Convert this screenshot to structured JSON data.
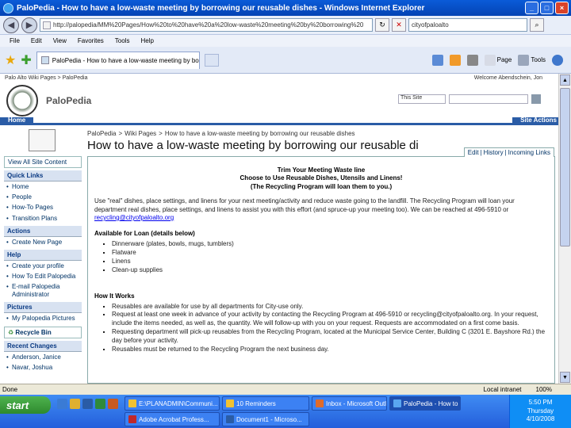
{
  "window": {
    "title": "PaloPedia - How to have a low-waste meeting by borrowing our reusable dishes - Windows Internet Explorer",
    "controls": [
      "_",
      "□",
      "×"
    ]
  },
  "address_bar": {
    "url": "http://palopedia/MM%20Pages/How%20to%20have%20a%20low-waste%20meeting%20by%20borrowing%20",
    "search_value": "cityofpaloalto"
  },
  "menu": [
    "File",
    "Edit",
    "View",
    "Favorites",
    "Tools",
    "Help"
  ],
  "tab": {
    "label": "PaloPedia - How to have a low-waste meeting by borr..."
  },
  "command_bar": {
    "page": "Page",
    "tools": "Tools"
  },
  "sharepoint": {
    "top_left": "Palo Alto Wiki Pages > PaloPedia",
    "top_right": "Welcome Abendschein, Jon",
    "site_name": "PaloPedia",
    "search_scope": "This Site",
    "home_tab": "Home",
    "site_actions": "Site Actions"
  },
  "breadcrumb": {
    "items": [
      "PaloPedia",
      "Wiki Pages",
      "How to have a low-waste meeting by borrowing our reusable dishes"
    ],
    "separator": ">"
  },
  "page_title": "How to have a low-waste meeting by borrowing our reusable di",
  "content_tabs": [
    "Edit",
    "History",
    "Incoming Links"
  ],
  "left_nav": {
    "view_all": "View All Site Content",
    "sections": [
      {
        "heading": "Quick Links",
        "items": [
          "Home",
          "People",
          "How-To Pages",
          "Transition Plans"
        ]
      },
      {
        "heading": "Actions",
        "items": [
          "Create New Page"
        ]
      },
      {
        "heading": "Help",
        "items": [
          "Create your profile",
          "How To Edit Palopedia",
          "E-mail Palopedia Administrator"
        ]
      },
      {
        "heading": "Pictures",
        "items": [
          "My Palopedia Pictures"
        ]
      }
    ],
    "recycle_bin": "Recycle Bin",
    "recent_heading": "Recent Changes",
    "recent_items": [
      "Anderson, Janice",
      "Navar, Joshua"
    ]
  },
  "content": {
    "banner": [
      "Trim Your Meeting Waste line",
      "Choose to Use Reusable Dishes, Utensils and Linens!",
      "(The Recycling Program will loan them to you.)"
    ],
    "intro": "Use \"real\" dishes, place settings, and linens for your next meeting/activity and reduce waste going to the landfill. The Recycling Program will loan your department real dishes, place settings, and linens to assist you with this effort (and spruce-up your meeting too). We can be reached at 496-5910 or",
    "email": "recycling@cityofpaloalto.org",
    "loan_heading": "Available for Loan (details below)",
    "loan_items": [
      "Dinnerware (plates, bowls, mugs, tumblers)",
      "Flatware",
      "Linens",
      "Clean-up supplies"
    ],
    "how_heading": "How It Works",
    "how_items": [
      "Reusables are available for use by all departments for City-use only.",
      "Request at least one week in advance of your activity by contacting the Recycling Program at 496-5910 or recycling@cityofpaloalto.org. In your request, include the items needed, as well as, the quantity. We will follow-up with you on your request. Requests are accommodated on a first come basis.",
      "Requesting department will pick-up reusables from the Recycling Program, located at the Municipal Service Center, Building C (3201 E. Bayshore Rd.) the day before your activity.",
      "Reusables must be returned to the Recycling Program the next business day."
    ]
  },
  "status_bar": {
    "left": "Done",
    "zone": "Local intranet",
    "zoom": "100%"
  },
  "taskbar": {
    "start": "start",
    "tasks": [
      "E:\\PLANADMIN\\Communi...",
      "10 Reminders",
      "Inbox - Microsoft Outl...",
      "PaloPedia - How to h...",
      "Adobe Acrobat Profess...",
      "Document1 - Microso..."
    ],
    "clock": {
      "time": "5:50 PM",
      "day": "Thursday",
      "date": "4/10/2008"
    }
  },
  "colors": {
    "title_bar": "#0a5bd8",
    "sp_blue": "#2a5ca6",
    "taskbar": "#245edb",
    "start_green": "#2e8a2e",
    "link": "#0000ee"
  }
}
